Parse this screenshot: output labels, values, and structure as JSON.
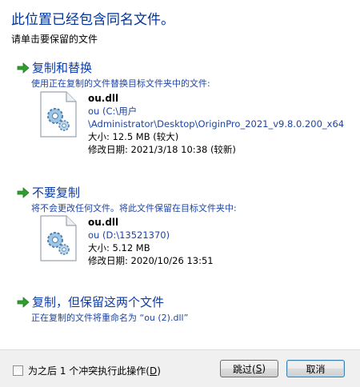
{
  "dialog": {
    "title": "此位置已经包含同名文件。",
    "subtitle": "请单击要保留的文件"
  },
  "options": {
    "replace": {
      "title": "复制和替换",
      "desc": "使用正在复制的文件替换目标文件夹中的文件:",
      "file": {
        "name": "ou.dll",
        "location_line1": "ou (C:\\用户",
        "location_line2": "\\Administrator\\Desktop\\OriginPro_2021_v9.8.0.200_x64",
        "size": "大小: 12.5 MB (较大)",
        "modified": "修改日期: 2021/3/18 10:38 (较新)"
      }
    },
    "skip": {
      "title": "不要复制",
      "desc": "将不会更改任何文件。将此文件保留在目标文件夹中:",
      "file": {
        "name": "ou.dll",
        "location": "ou (D:\\13521370)",
        "size": "大小: 5.12 MB",
        "modified": "修改日期: 2020/10/26 13:51"
      }
    },
    "keep_both": {
      "title": "复制，但保留这两个文件",
      "desc": "正在复制的文件将重命名为 “ou (2).dll”"
    }
  },
  "footer": {
    "checkbox_label_prefix": "为之后 1 个冲突执行此操作(",
    "checkbox_label_key": "D",
    "checkbox_label_suffix": ")",
    "skip_button_prefix": "跳过(",
    "skip_button_key": "S",
    "skip_button_suffix": ")",
    "cancel_button": "取消"
  },
  "colors": {
    "title": "#003399",
    "link": "#1d44a5",
    "arrow_green": "#2f9e2f"
  },
  "icons": {
    "option_arrow": "green-arrow-icon",
    "file": "dll-file-gear-icon"
  }
}
